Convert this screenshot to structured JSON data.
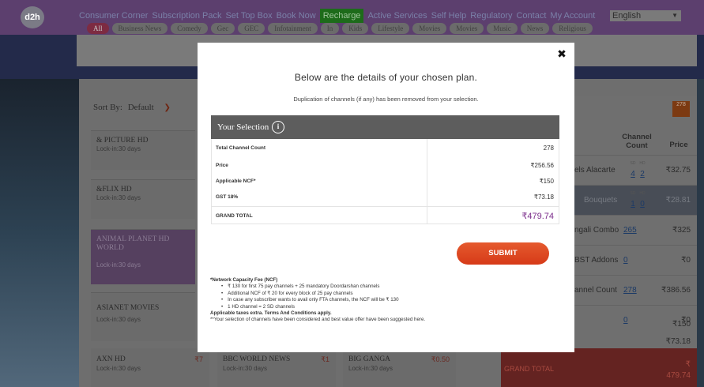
{
  "header": {
    "logo_text": "d2h",
    "nav": [
      "Consumer Corner",
      "Subscription Pack",
      "Set Top Box",
      "Book Now",
      "Recharge",
      "Active Services",
      "Self Help",
      "Regulatory",
      "Contact",
      "My Account"
    ],
    "language": "English",
    "categories": [
      "All",
      "Business News",
      "Comedy",
      "Gec",
      "GEC",
      "Infotainment",
      "In",
      "Kids",
      "Lifestyle",
      "Movies",
      "Movies",
      "Music",
      "News",
      "Religious"
    ]
  },
  "sort": {
    "label": "Sort By:",
    "value": "Default"
  },
  "plans": [
    {
      "name": "& PICTURE HD",
      "lock": "Lock-in:30 days"
    },
    {
      "name": "&FLIX HD",
      "lock": "Lock-in:30 days"
    },
    {
      "name": "ANIMAL PLANET HD WORLD",
      "lock": "Lock-in:30 days"
    },
    {
      "name": "ASIANET MOVIES",
      "lock": "Lock-in:30 days"
    },
    {
      "name": "AXN HD",
      "lock": "Lock-in:30 days",
      "price": "₹7"
    }
  ],
  "bottom_cards": [
    {
      "name": "BBC WORLD NEWS",
      "lock": "Lock-in:30 days",
      "price": "₹1"
    },
    {
      "name": "BIG GANGA",
      "lock": "Lock-in:30 days",
      "price": "₹0.50"
    }
  ],
  "summary_panel": {
    "cart_count": "278",
    "header_count": "Channel Count",
    "header_price": "Price",
    "rows": [
      {
        "label": "els Alacarte",
        "sd": "4",
        "hd": "2",
        "price": "₹32.75"
      },
      {
        "label": "Bouquets",
        "sd": "1",
        "hd": "0",
        "price": "₹28.81"
      },
      {
        "label": "ngali Combo",
        "count": "265",
        "price": "₹325"
      },
      {
        "label": "BST Addons",
        "count": "0",
        "price": "₹0"
      },
      {
        "label": "annel Count",
        "count": "278",
        "price": "₹386.56"
      },
      {
        "label": "",
        "count": "0",
        "price": "₹0"
      },
      {
        "label": "",
        "price": "₹150"
      },
      {
        "label": "",
        "price": "₹73.18"
      }
    ],
    "mini_sd": "SD",
    "mini_hd": "HD",
    "grand_total_label": "GRAND TOTAL",
    "grand_total_symbol": "₹",
    "grand_total_value": "479.74"
  },
  "modal": {
    "close_glyph": "✖",
    "title": "Below are the details of your chosen plan.",
    "subtitle": "Duplication of channels (if any) has been removed from your selection.",
    "selection_header": "Your Selection",
    "info_glyph": "i",
    "rows": [
      {
        "label": "Total Channel Count",
        "value": "278"
      },
      {
        "label": "Price",
        "value": "₹256.56"
      },
      {
        "label": "Applicable NCF*",
        "value": "₹150"
      },
      {
        "label": "GST 18%",
        "value": "₹73.18"
      }
    ],
    "grand_total_label": "GRAND TOTAL",
    "grand_total_value": "₹479.74",
    "submit_label": "SUBMIT",
    "ncf_heading": "*Network Capacity Fee (NCF)",
    "ncf_points": [
      "₹ 130 for first 75 pay channels + 25 mandatory Doordarshan channels",
      "Additional NCF of ₹ 20 for every block of 25 pay channels",
      "In case any subscriber wants to avail only FTA channels, the NCF will be ₹ 130",
      "1 HD channel = 2 SD channels"
    ],
    "taxes_note": "Applicable taxes extra. Terms And Conditions apply.",
    "suggestion_note": "**Your selection of channels have been considered and best value offer have been suggested here."
  },
  "colors": {
    "overlay_bg": "#5a5a5a",
    "header_purple": "#5c3f6e",
    "selection_header": "#5d5d5d",
    "submit": "#e04a22",
    "grand_total": "#7a2b8a"
  }
}
